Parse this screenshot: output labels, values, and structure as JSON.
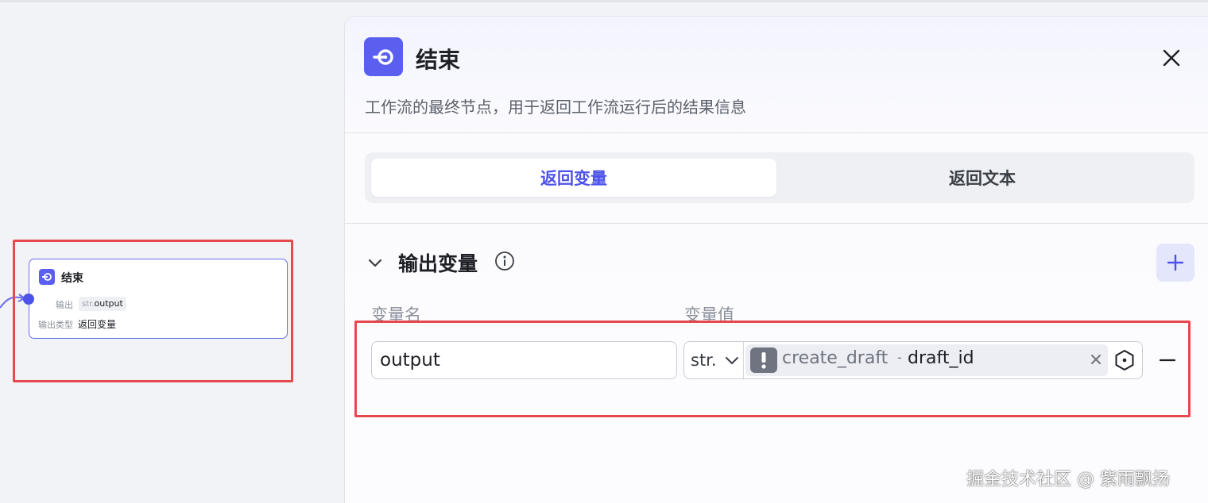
{
  "canvas": {
    "node": {
      "title": "结束",
      "output_label": "输出",
      "output_type": "str.",
      "output_name": "output",
      "output_kind_label": "输出类型",
      "output_kind_value": "返回变量"
    }
  },
  "panel": {
    "title": "结束",
    "description": "工作流的最终节点，用于返回工作流运行后的结果信息",
    "tabs": [
      {
        "label": "返回变量",
        "active": true
      },
      {
        "label": "返回文本",
        "active": false
      }
    ],
    "section": {
      "title": "输出变量",
      "columns": {
        "name": "变量名",
        "value": "变量值"
      },
      "rows": [
        {
          "name": "output",
          "type": "str.",
          "ref_node": "create_draft",
          "ref_field": "draft_id"
        }
      ]
    }
  },
  "watermark": "掘金技术社区 @ 紫雨飘扬",
  "colors": {
    "accent": "#4d53e8",
    "node_icon": "#5a5ff0",
    "highlight_box": "#e5484d"
  }
}
